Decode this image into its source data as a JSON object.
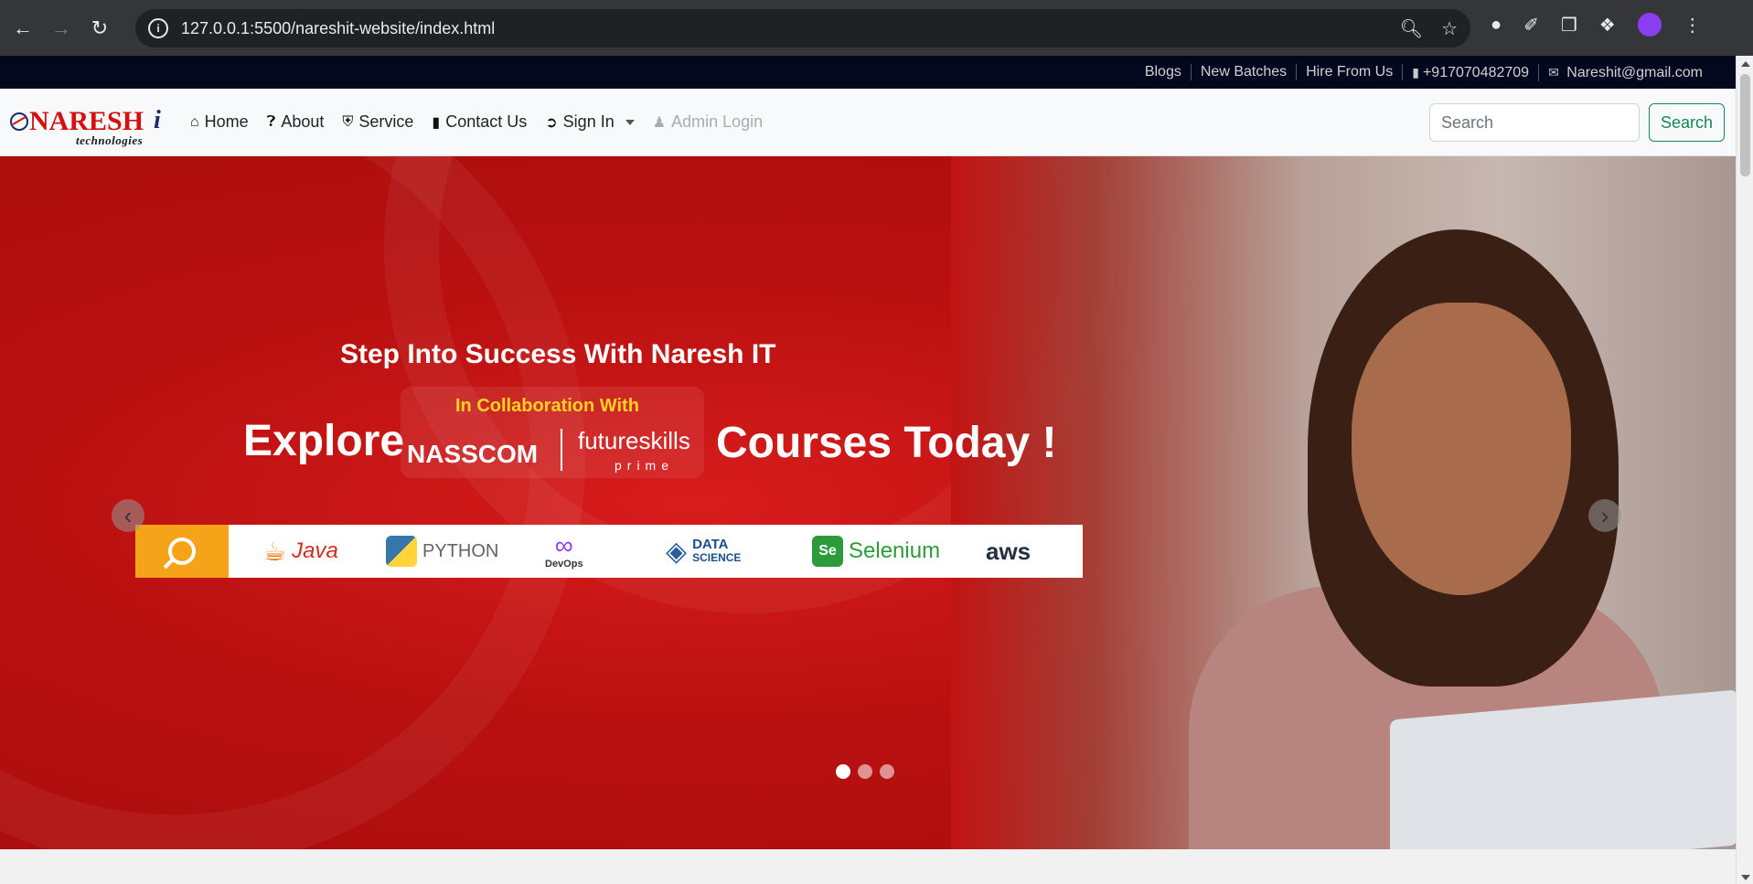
{
  "browser": {
    "url_host": "127.0.0.1",
    "url_path": ":5500/nareshit-website/index.html"
  },
  "topbar": {
    "blogs": "Blogs",
    "new_batches": "New Batches",
    "hire": "Hire From Us",
    "phone": "+917070482709",
    "email": "Nareshit@gmail.com"
  },
  "logo": {
    "brand": "NARESH",
    "brand_i": "i",
    "sub": "technologies"
  },
  "nav": {
    "home": "Home",
    "about": "About",
    "service": "Service",
    "contact": "Contact Us",
    "sign_in": "Sign In",
    "admin": "Admin Login"
  },
  "search": {
    "placeholder": "Search",
    "button": "Search"
  },
  "hero": {
    "headline": "Step Into Success With Naresh IT",
    "collab": "In Collaboration With",
    "explore": "Explore",
    "nasscom": "NASSCOM",
    "futureskills": "futureskills",
    "prime": "prime",
    "courses": "Courses Today !",
    "techs": [
      "Java",
      "PYTHON",
      "DevOps",
      "DATA",
      "SCIENCE",
      "Selenium",
      "aws"
    ]
  },
  "colors": {
    "accent_red": "#c11414",
    "topbar_bg": "#04081f",
    "search_green": "#198754",
    "strip_orange": "#f5a419"
  }
}
